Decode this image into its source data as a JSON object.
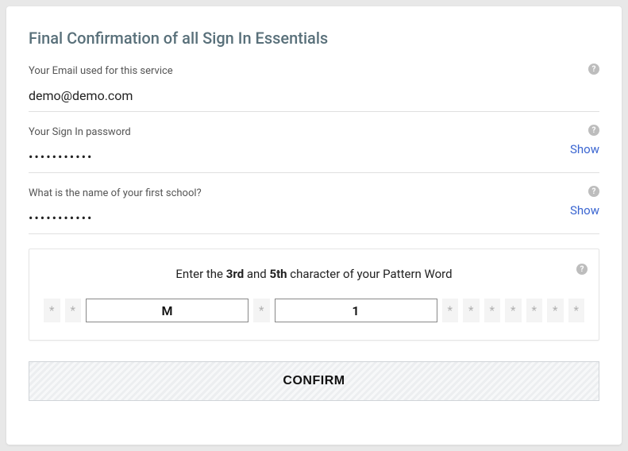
{
  "title": "Final Confirmation of all Sign In Essentials",
  "fields": {
    "email": {
      "label": "Your Email used for this service",
      "value": "demo@demo.com"
    },
    "password": {
      "label": "Your Sign In password",
      "masked": "•••••••••••",
      "show_label": "Show"
    },
    "security": {
      "label": "What is the name of your first school?",
      "masked": "•••••••••••",
      "show_label": "Show"
    }
  },
  "pattern": {
    "instruction_prefix": "Enter the ",
    "pos1": "3rd",
    "mid": " and ",
    "pos2": "5th",
    "instruction_suffix": " character of your Pattern Word",
    "cells": [
      {
        "active": false,
        "value": "*"
      },
      {
        "active": false,
        "value": "*"
      },
      {
        "active": true,
        "value": "M"
      },
      {
        "active": false,
        "value": "*"
      },
      {
        "active": true,
        "value": "1"
      },
      {
        "active": false,
        "value": "*"
      },
      {
        "active": false,
        "value": "*"
      },
      {
        "active": false,
        "value": "*"
      },
      {
        "active": false,
        "value": "*"
      },
      {
        "active": false,
        "value": "*"
      },
      {
        "active": false,
        "value": "*"
      },
      {
        "active": false,
        "value": "*"
      }
    ]
  },
  "confirm_label": "CONFIRM",
  "help_glyph": "?"
}
